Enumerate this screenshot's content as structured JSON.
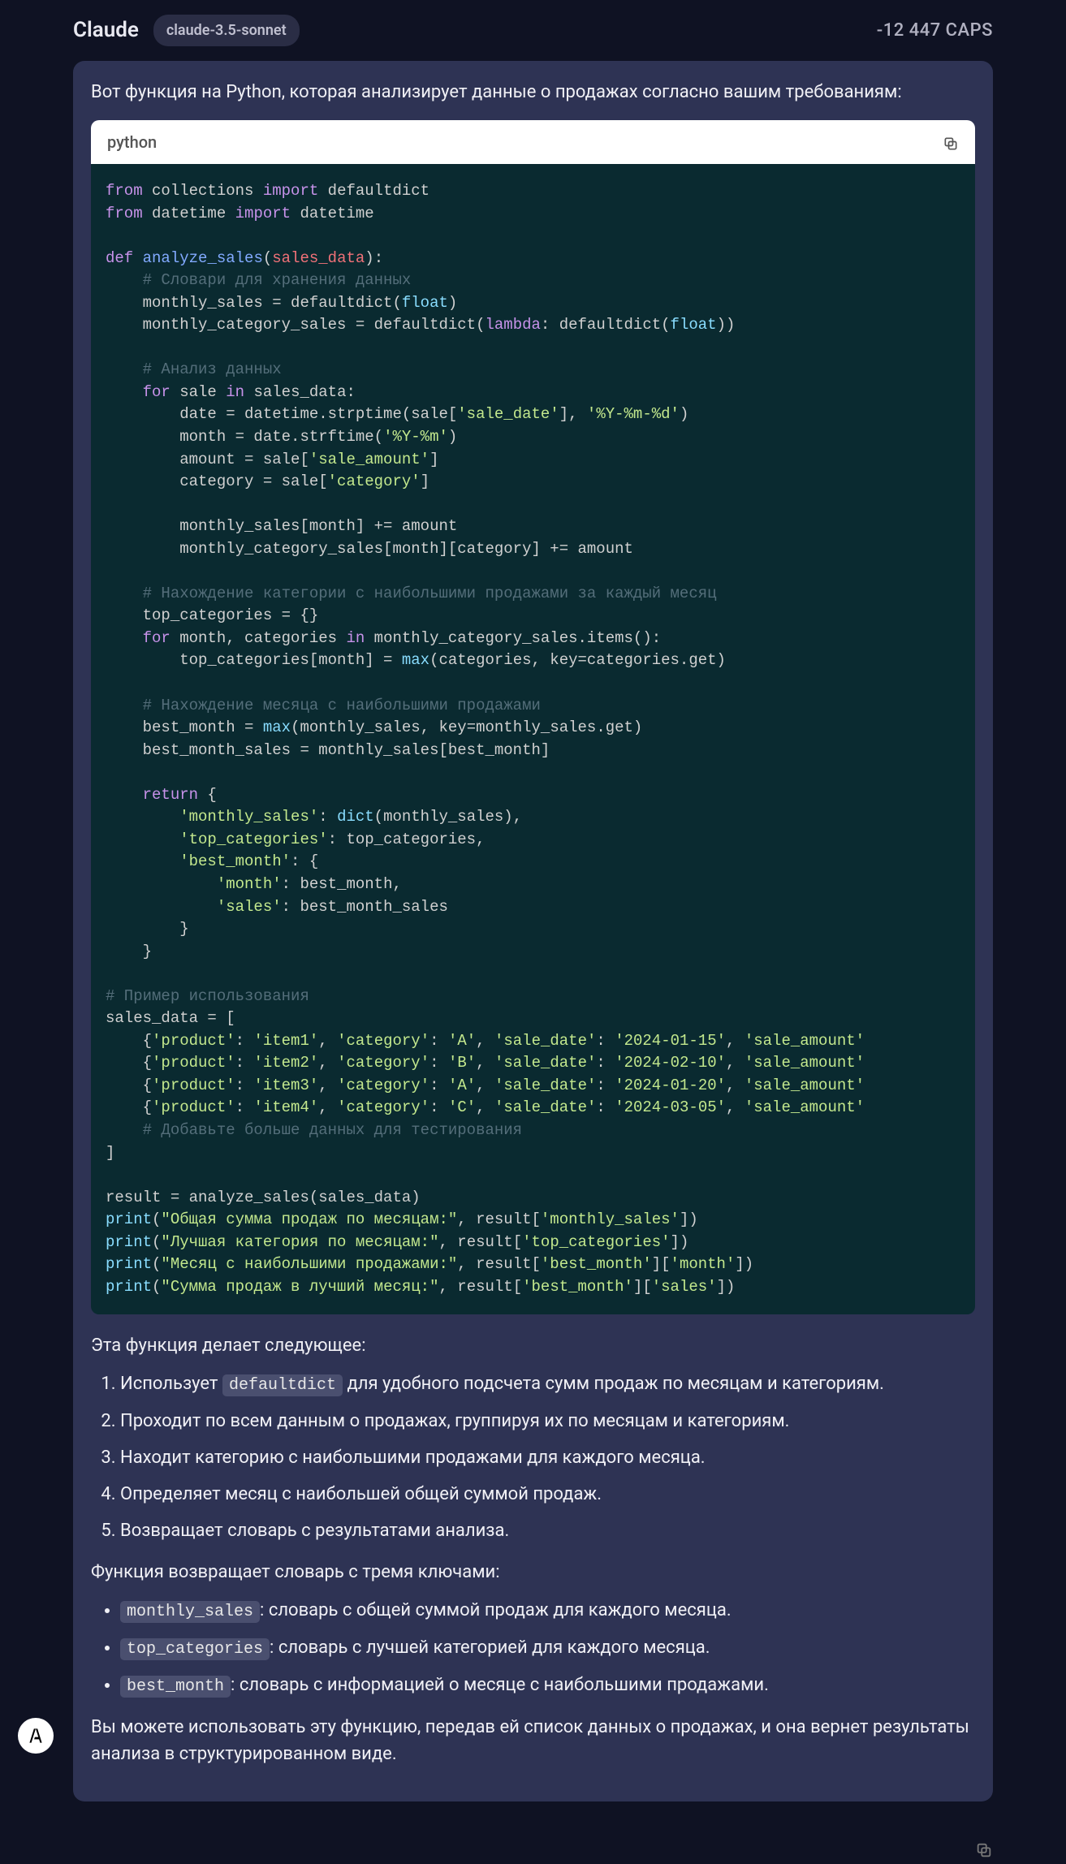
{
  "header": {
    "title": "Claude",
    "model_badge": "claude-3.5-sonnet",
    "caps": "-12 447 CAPS"
  },
  "intro": "Вот функция на Python, которая анализирует данные о продажах согласно вашим требованиям:",
  "code_header": {
    "lang": "python"
  },
  "code_lines": [
    [
      [
        "kw",
        "from"
      ],
      [
        "ident",
        " collections "
      ],
      [
        "kw",
        "import"
      ],
      [
        "ident",
        " defaultdict"
      ]
    ],
    [
      [
        "kw",
        "from"
      ],
      [
        "ident",
        " datetime "
      ],
      [
        "kw",
        "import"
      ],
      [
        "ident",
        " datetime"
      ]
    ],
    [],
    [
      [
        "kw",
        "def"
      ],
      [
        "ident",
        " "
      ],
      [
        "fn",
        "analyze_sales"
      ],
      [
        "ident",
        "("
      ],
      [
        "param",
        "sales_data"
      ],
      [
        "ident",
        "):"
      ]
    ],
    [
      [
        "ident",
        "    "
      ],
      [
        "cmt",
        "# Словари для хранения данных"
      ]
    ],
    [
      [
        "ident",
        "    monthly_sales = defaultdict("
      ],
      [
        "fncall",
        "float"
      ],
      [
        "ident",
        ")"
      ]
    ],
    [
      [
        "ident",
        "    monthly_category_sales = defaultdict("
      ],
      [
        "kw",
        "lambda"
      ],
      [
        "ident",
        ": defaultdict("
      ],
      [
        "fncall",
        "float"
      ],
      [
        "ident",
        "))"
      ]
    ],
    [],
    [
      [
        "ident",
        "    "
      ],
      [
        "cmt",
        "# Анализ данных"
      ]
    ],
    [
      [
        "ident",
        "    "
      ],
      [
        "kw",
        "for"
      ],
      [
        "ident",
        " sale "
      ],
      [
        "kw",
        "in"
      ],
      [
        "ident",
        " sales_data:"
      ]
    ],
    [
      [
        "ident",
        "        date = datetime.strptime(sale["
      ],
      [
        "str",
        "'sale_date'"
      ],
      [
        "ident",
        "], "
      ],
      [
        "str",
        "'%Y-%m-%d'"
      ],
      [
        "ident",
        ")"
      ]
    ],
    [
      [
        "ident",
        "        month = date.strftime("
      ],
      [
        "str",
        "'%Y-%m'"
      ],
      [
        "ident",
        ")"
      ]
    ],
    [
      [
        "ident",
        "        amount = sale["
      ],
      [
        "str",
        "'sale_amount'"
      ],
      [
        "ident",
        "]"
      ]
    ],
    [
      [
        "ident",
        "        category = sale["
      ],
      [
        "str",
        "'category'"
      ],
      [
        "ident",
        "]"
      ]
    ],
    [],
    [
      [
        "ident",
        "        monthly_sales[month] += amount"
      ]
    ],
    [
      [
        "ident",
        "        monthly_category_sales[month][category] += amount"
      ]
    ],
    [],
    [
      [
        "ident",
        "    "
      ],
      [
        "cmt",
        "# Нахождение категории с наибольшими продажами за каждый месяц"
      ]
    ],
    [
      [
        "ident",
        "    top_categories = {}"
      ]
    ],
    [
      [
        "ident",
        "    "
      ],
      [
        "kw",
        "for"
      ],
      [
        "ident",
        " month, categories "
      ],
      [
        "kw",
        "in"
      ],
      [
        "ident",
        " monthly_category_sales.items():"
      ]
    ],
    [
      [
        "ident",
        "        top_categories[month] = "
      ],
      [
        "fncall",
        "max"
      ],
      [
        "ident",
        "(categories, key=categories.get)"
      ]
    ],
    [],
    [
      [
        "ident",
        "    "
      ],
      [
        "cmt",
        "# Нахождение месяца с наибольшими продажами"
      ]
    ],
    [
      [
        "ident",
        "    best_month = "
      ],
      [
        "fncall",
        "max"
      ],
      [
        "ident",
        "(monthly_sales, key=monthly_sales.get)"
      ]
    ],
    [
      [
        "ident",
        "    best_month_sales = monthly_sales[best_month]"
      ]
    ],
    [],
    [
      [
        "ident",
        "    "
      ],
      [
        "kw",
        "return"
      ],
      [
        "ident",
        " {"
      ]
    ],
    [
      [
        "ident",
        "        "
      ],
      [
        "str",
        "'monthly_sales'"
      ],
      [
        "ident",
        ": "
      ],
      [
        "fncall",
        "dict"
      ],
      [
        "ident",
        "(monthly_sales),"
      ]
    ],
    [
      [
        "ident",
        "        "
      ],
      [
        "str",
        "'top_categories'"
      ],
      [
        "ident",
        ": top_categories,"
      ]
    ],
    [
      [
        "ident",
        "        "
      ],
      [
        "str",
        "'best_month'"
      ],
      [
        "ident",
        ": {"
      ]
    ],
    [
      [
        "ident",
        "            "
      ],
      [
        "str",
        "'month'"
      ],
      [
        "ident",
        ": best_month,"
      ]
    ],
    [
      [
        "ident",
        "            "
      ],
      [
        "str",
        "'sales'"
      ],
      [
        "ident",
        ": best_month_sales"
      ]
    ],
    [
      [
        "ident",
        "        }"
      ]
    ],
    [
      [
        "ident",
        "    }"
      ]
    ],
    [],
    [
      [
        "cmt",
        "# Пример использования"
      ]
    ],
    [
      [
        "ident",
        "sales_data = ["
      ]
    ],
    [
      [
        "ident",
        "    {"
      ],
      [
        "str",
        "'product'"
      ],
      [
        "ident",
        ": "
      ],
      [
        "str",
        "'item1'"
      ],
      [
        "ident",
        ", "
      ],
      [
        "str",
        "'category'"
      ],
      [
        "ident",
        ": "
      ],
      [
        "str",
        "'A'"
      ],
      [
        "ident",
        ", "
      ],
      [
        "str",
        "'sale_date'"
      ],
      [
        "ident",
        ": "
      ],
      [
        "str",
        "'2024-01-15'"
      ],
      [
        "ident",
        ", "
      ],
      [
        "str",
        "'sale_amount'"
      ]
    ],
    [
      [
        "ident",
        "    {"
      ],
      [
        "str",
        "'product'"
      ],
      [
        "ident",
        ": "
      ],
      [
        "str",
        "'item2'"
      ],
      [
        "ident",
        ", "
      ],
      [
        "str",
        "'category'"
      ],
      [
        "ident",
        ": "
      ],
      [
        "str",
        "'B'"
      ],
      [
        "ident",
        ", "
      ],
      [
        "str",
        "'sale_date'"
      ],
      [
        "ident",
        ": "
      ],
      [
        "str",
        "'2024-02-10'"
      ],
      [
        "ident",
        ", "
      ],
      [
        "str",
        "'sale_amount'"
      ]
    ],
    [
      [
        "ident",
        "    {"
      ],
      [
        "str",
        "'product'"
      ],
      [
        "ident",
        ": "
      ],
      [
        "str",
        "'item3'"
      ],
      [
        "ident",
        ", "
      ],
      [
        "str",
        "'category'"
      ],
      [
        "ident",
        ": "
      ],
      [
        "str",
        "'A'"
      ],
      [
        "ident",
        ", "
      ],
      [
        "str",
        "'sale_date'"
      ],
      [
        "ident",
        ": "
      ],
      [
        "str",
        "'2024-01-20'"
      ],
      [
        "ident",
        ", "
      ],
      [
        "str",
        "'sale_amount'"
      ]
    ],
    [
      [
        "ident",
        "    {"
      ],
      [
        "str",
        "'product'"
      ],
      [
        "ident",
        ": "
      ],
      [
        "str",
        "'item4'"
      ],
      [
        "ident",
        ", "
      ],
      [
        "str",
        "'category'"
      ],
      [
        "ident",
        ": "
      ],
      [
        "str",
        "'C'"
      ],
      [
        "ident",
        ", "
      ],
      [
        "str",
        "'sale_date'"
      ],
      [
        "ident",
        ": "
      ],
      [
        "str",
        "'2024-03-05'"
      ],
      [
        "ident",
        ", "
      ],
      [
        "str",
        "'sale_amount'"
      ]
    ],
    [
      [
        "ident",
        "    "
      ],
      [
        "cmt",
        "# Добавьте больше данных для тестирования"
      ]
    ],
    [
      [
        "ident",
        "]"
      ]
    ],
    [],
    [
      [
        "ident",
        "result = analyze_sales(sales_data)"
      ]
    ],
    [
      [
        "fncall",
        "print"
      ],
      [
        "ident",
        "("
      ],
      [
        "str",
        "\"Общая сумма продаж по месяцам:\""
      ],
      [
        "ident",
        ", result["
      ],
      [
        "str",
        "'monthly_sales'"
      ],
      [
        "ident",
        "])"
      ]
    ],
    [
      [
        "fncall",
        "print"
      ],
      [
        "ident",
        "("
      ],
      [
        "str",
        "\"Лучшая категория по месяцам:\""
      ],
      [
        "ident",
        ", result["
      ],
      [
        "str",
        "'top_categories'"
      ],
      [
        "ident",
        "])"
      ]
    ],
    [
      [
        "fncall",
        "print"
      ],
      [
        "ident",
        "("
      ],
      [
        "str",
        "\"Месяц с наибольшими продажами:\""
      ],
      [
        "ident",
        ", result["
      ],
      [
        "str",
        "'best_month'"
      ],
      [
        "ident",
        "]["
      ],
      [
        "str",
        "'month'"
      ],
      [
        "ident",
        "])"
      ]
    ],
    [
      [
        "fncall",
        "print"
      ],
      [
        "ident",
        "("
      ],
      [
        "str",
        "\"Сумма продаж в лучший месяц:\""
      ],
      [
        "ident",
        ", result["
      ],
      [
        "str",
        "'best_month'"
      ],
      [
        "ident",
        "]["
      ],
      [
        "str",
        "'sales'"
      ],
      [
        "ident",
        "])"
      ]
    ]
  ],
  "desc1": "Эта функция делает следующее:",
  "steps": [
    {
      "pre": "Использует ",
      "code": "defaultdict",
      "post": " для удобного подсчета сумм продаж по месяцам и категориям."
    },
    {
      "text": "Проходит по всем данным о продажах, группируя их по месяцам и категориям."
    },
    {
      "text": "Находит категорию с наибольшими продажами для каждого месяца."
    },
    {
      "text": "Определяет месяц с наибольшей общей суммой продаж."
    },
    {
      "text": "Возвращает словарь с результатами анализа."
    }
  ],
  "desc2": "Функция возвращает словарь с тремя ключами:",
  "bullets": [
    {
      "code": "monthly_sales",
      "text": ": словарь с общей суммой продаж для каждого месяца."
    },
    {
      "code": "top_categories",
      "text": ": словарь с лучшей категорией для каждого месяца."
    },
    {
      "code": "best_month",
      "text": ": словарь с информацией о месяце с наибольшими продажами."
    }
  ],
  "outro": "Вы можете использовать эту функцию, передав ей список данных о продажах, и она вернет результаты анализа в структурированном виде."
}
